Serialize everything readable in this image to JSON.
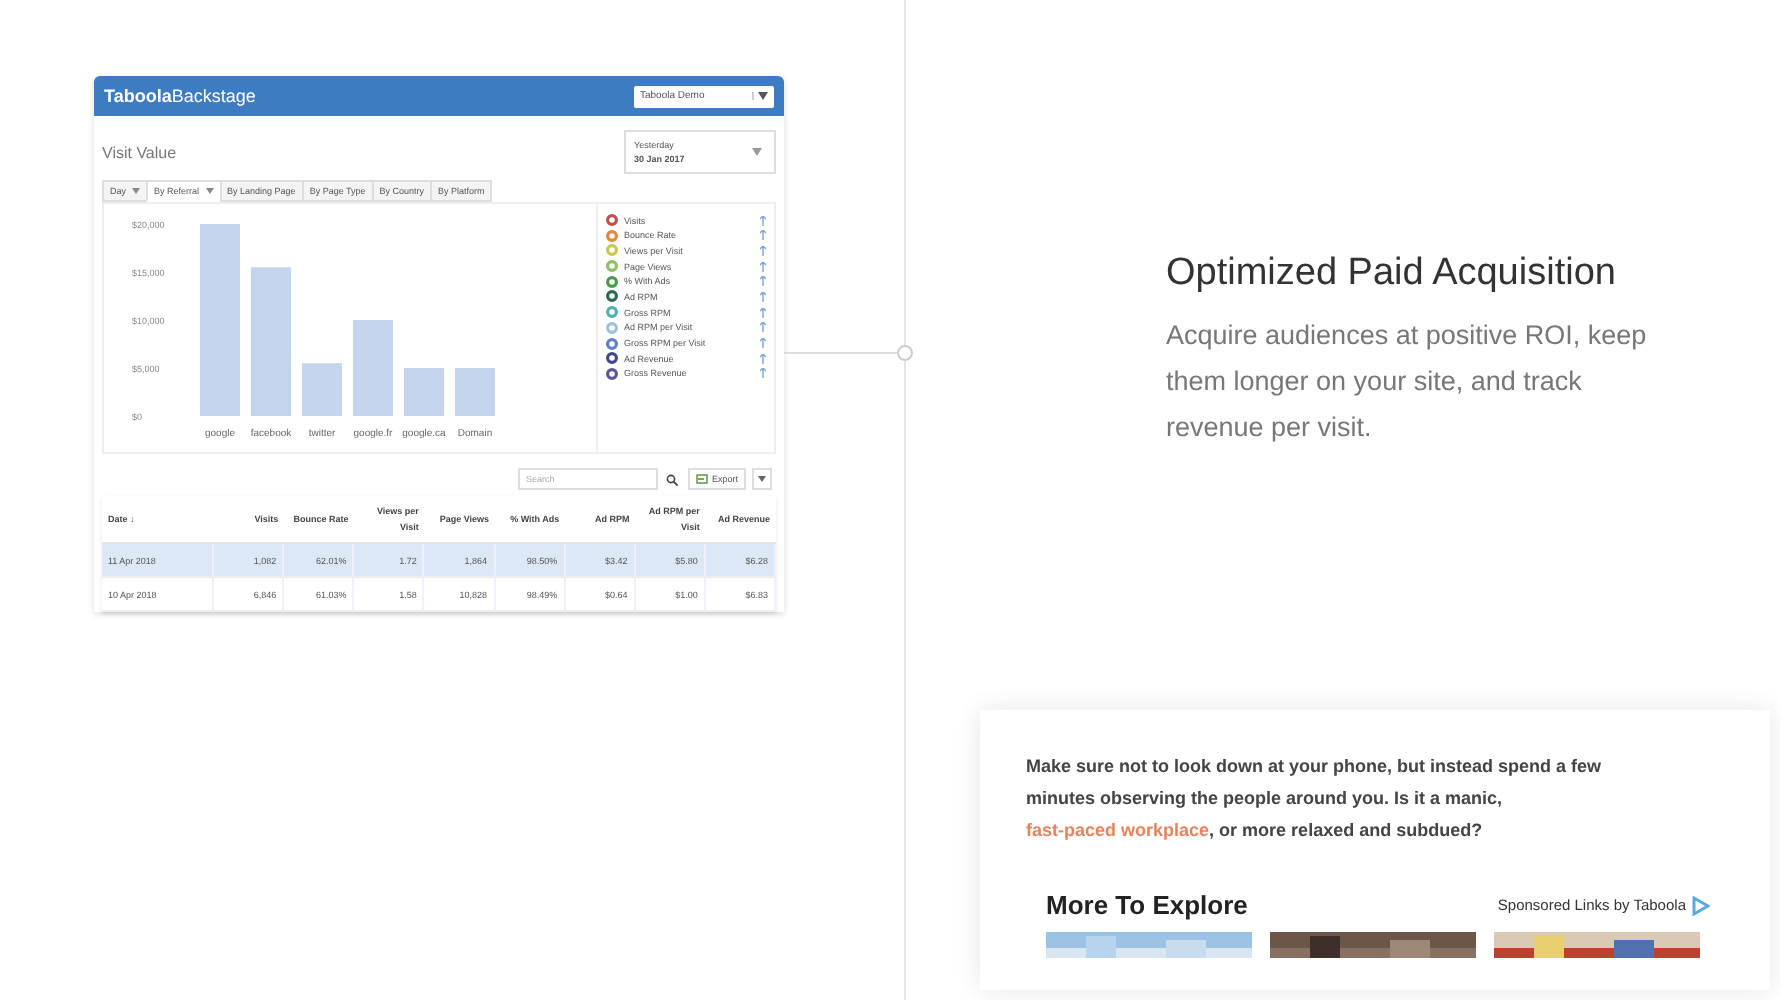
{
  "dashboard": {
    "logo_bold": "Taboola",
    "logo_light": "Backstage",
    "account_select": "Taboola Demo",
    "title": "Visit Value",
    "date_picker": {
      "label": "Yesterday",
      "date": "30 Jan 2017"
    },
    "tabs": [
      {
        "label": "Day",
        "dropdown": true,
        "selected": false
      },
      {
        "label": "By Referral",
        "dropdown": true,
        "selected": true
      },
      {
        "label": "By Landing Page",
        "dropdown": false,
        "selected": false
      },
      {
        "label": "By Page Type",
        "dropdown": false,
        "selected": false
      },
      {
        "label": "By Country",
        "dropdown": false,
        "selected": false
      },
      {
        "label": "By Platform",
        "dropdown": false,
        "selected": false
      }
    ],
    "chart_data": {
      "type": "bar",
      "categories": [
        "google",
        "facebook",
        "twitter",
        "google.fr",
        "google.ca",
        "Domain"
      ],
      "values": [
        20000,
        15500,
        5500,
        10000,
        5000,
        5000
      ],
      "ylim": [
        0,
        20000
      ],
      "yticks": [
        {
          "value": 0,
          "label": "$0"
        },
        {
          "value": 5000,
          "label": "$5,000"
        },
        {
          "value": 10000,
          "label": "$10,000"
        },
        {
          "value": 15000,
          "label": "$15,000"
        },
        {
          "value": 20000,
          "label": "$20,000"
        }
      ]
    },
    "metrics": [
      {
        "label": "Visits",
        "color": "#c0504d"
      },
      {
        "label": "Bounce Rate",
        "color": "#e08a3c"
      },
      {
        "label": "Views per Visit",
        "color": "#c8c850"
      },
      {
        "label": "Page Views",
        "color": "#8cc060"
      },
      {
        "label": "% With Ads",
        "color": "#4a9a4a"
      },
      {
        "label": "Ad RPM",
        "color": "#2a6a4a"
      },
      {
        "label": "Gross RPM",
        "color": "#50b0b0"
      },
      {
        "label": "Ad RPM per Visit",
        "color": "#a0c0e0"
      },
      {
        "label": "Gross RPM per Visit",
        "color": "#6080c0"
      },
      {
        "label": "Ad Revenue",
        "color": "#404890"
      },
      {
        "label": "Gross Revenue",
        "color": "#6050a0"
      }
    ],
    "search": {
      "placeholder": "Search"
    },
    "export_button": "Export",
    "table": {
      "columns": [
        "Date ↓",
        "Visits",
        "Bounce Rate",
        "Views per Visit",
        "Page Views",
        "% With Ads",
        "Ad RPM",
        "Ad RPM per Visit",
        "Ad Revenue"
      ],
      "rows": [
        {
          "selected": true,
          "cells": [
            "11 Apr 2018",
            "1,082",
            "62.01%",
            "1.72",
            "1,864",
            "98.50%",
            "$3.42",
            "$5.80",
            "$6.28"
          ]
        },
        {
          "selected": false,
          "cells": [
            "10 Apr 2018",
            "6,846",
            "61.03%",
            "1.58",
            "10,828",
            "98.49%",
            "$0.64",
            "$1.00",
            "$6.83"
          ]
        }
      ]
    }
  },
  "feature": {
    "heading": "Optimized Paid Acquisition",
    "description": "Acquire audiences at positive ROI, keep them longer on your site, and track revenue per visit."
  },
  "article_card": {
    "text_before": "Make sure not to look down at your phone, but instead spend a few minutes observing the people around you. Is it a manic, ",
    "link": "fast-paced workplace",
    "text_after": ", or more relaxed and subdued?",
    "more_heading": "More To Explore",
    "sponsored": "Sponsored Links by Taboola"
  }
}
